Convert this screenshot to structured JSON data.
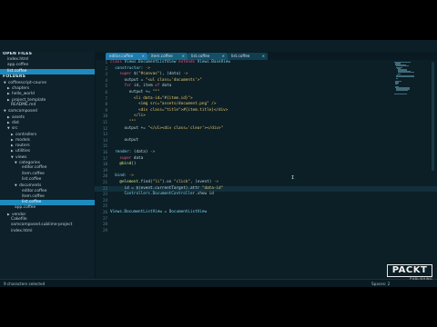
{
  "sidebar": {
    "open_files_heading": "OPEN FILES",
    "open_files": [
      {
        "label": "index.html",
        "indent": 1
      },
      {
        "label": "app.coffee",
        "indent": 1
      },
      {
        "label": "list.coffee",
        "indent": 1,
        "selected": true
      }
    ],
    "folders_heading": "FOLDERS",
    "folders": [
      {
        "label": "coffeescript-course",
        "indent": 0,
        "tri": "▼"
      },
      {
        "label": "chapters",
        "indent": 1,
        "tri": "▶"
      },
      {
        "label": "hello_world",
        "indent": 1,
        "tri": "▶"
      },
      {
        "label": "project_template",
        "indent": 1,
        "tri": "▶"
      },
      {
        "label": "README.md",
        "indent": 2
      },
      {
        "label": "samcomposed",
        "indent": 0,
        "tri": "▼"
      },
      {
        "label": "assets",
        "indent": 1,
        "tri": "▶"
      },
      {
        "label": "dist",
        "indent": 1,
        "tri": "▶"
      },
      {
        "label": "src",
        "indent": 1,
        "tri": "▼"
      },
      {
        "label": "controllers",
        "indent": 2,
        "tri": "▶"
      },
      {
        "label": "models",
        "indent": 2,
        "tri": "▶"
      },
      {
        "label": "routers",
        "indent": 2,
        "tri": "▶"
      },
      {
        "label": "utilities",
        "indent": 2,
        "tri": "▶"
      },
      {
        "label": "views",
        "indent": 2,
        "tri": "▼"
      },
      {
        "label": "categories",
        "indent": 3,
        "tri": "▼"
      },
      {
        "label": "editor.coffee",
        "indent": 5
      },
      {
        "label": "item.coffee",
        "indent": 5
      },
      {
        "label": "list.coffee",
        "indent": 5
      },
      {
        "label": "documents",
        "indent": 3,
        "tri": "▼"
      },
      {
        "label": "editor.coffee",
        "indent": 5
      },
      {
        "label": "item.coffee",
        "indent": 5
      },
      {
        "label": "list.coffee",
        "indent": 5,
        "selected": true
      },
      {
        "label": "app.coffee",
        "indent": 3
      },
      {
        "label": "vendor",
        "indent": 1,
        "tri": "▶"
      },
      {
        "label": "Cakefile",
        "indent": 2
      },
      {
        "label": "samcomposed.sublime-project",
        "indent": 2
      },
      {
        "label": "index.html",
        "indent": 2
      }
    ]
  },
  "tabs": [
    {
      "label": "editor.coffee",
      "cls": "t1"
    },
    {
      "label": "item.coffee",
      "cls": "t2"
    },
    {
      "label": "list.coffee",
      "cls": "t3"
    },
    {
      "label": "list.coffee",
      "cls": "t4"
    }
  ],
  "tab_close": "×",
  "editor": {
    "highlight_line": 22,
    "lines": [
      {
        "n": "1",
        "html": "<span class='k'>class</span> <span class='f'>Views.DocumentListView</span> <span class='k'>extends</span> <span class='f'>Views.BaseView</span>"
      },
      {
        "n": "2",
        "html": "  <span class='f'>constructor</span>: <span class='p'>-&gt;</span>"
      },
      {
        "n": "3",
        "html": "    <span class='k'>super</span> $(<span class='s'>\"#canvas\"</span>), (data) <span class='p'>-&gt;</span>"
      },
      {
        "n": "4",
        "html": "      output = <span class='s'>\"&lt;ul class='documents'&gt;\"</span>"
      },
      {
        "n": "5",
        "html": "      <span class='k'>for</span> id, item <span class='k'>of</span> data"
      },
      {
        "n": "6",
        "html": "        output += <span class='s'>\"\"\"</span>"
      },
      {
        "n": "7",
        "html": "<span class='s'>          &lt;li data-id=\"#{item.id}\"&gt;</span>"
      },
      {
        "n": "8",
        "html": "<span class='s'>            &lt;img src=\"assets/document.png\" /&gt;</span>"
      },
      {
        "n": "9",
        "html": "<span class='s'>            &lt;div class=\"title\"&gt;#{item.title}&lt;/div&gt;</span>"
      },
      {
        "n": "10",
        "html": "<span class='s'>          &lt;/li&gt;</span>"
      },
      {
        "n": "11",
        "html": "<span class='s'>        \"\"\"</span>"
      },
      {
        "n": "12",
        "html": "      output += <span class='s'>\"&lt;/ul&gt;&lt;div class='clear'&gt;&lt;/div&gt;\"</span>"
      },
      {
        "n": "13",
        "html": ""
      },
      {
        "n": "14",
        "html": "      output"
      },
      {
        "n": "15",
        "html": ""
      },
      {
        "n": "16",
        "html": "  <span class='f'>render</span>: (data) <span class='p'>-&gt;</span>"
      },
      {
        "n": "17",
        "html": "    <span class='k'>super</span> data"
      },
      {
        "n": "18",
        "html": "    <span class='v'>@bind</span>()"
      },
      {
        "n": "19",
        "html": ""
      },
      {
        "n": "20",
        "html": "  <span class='f'>bind</span>: <span class='p'>-&gt;</span>"
      },
      {
        "n": "21",
        "html": "    <span class='v'>@element</span>.find(<span class='s'>\"li\"</span>).on <span class='s'>\"click\"</span>, (event) <span class='p'>-&gt;</span>"
      },
      {
        "n": "22",
        "html": "      id = $(event.currentTarget).attr <span class='s'>\"data-id\"</span>"
      },
      {
        "n": "23",
        "html": "      <span class='f'>Controllers.DocumentController</span>.show id"
      },
      {
        "n": "24",
        "html": ""
      },
      {
        "n": "25",
        "html": ""
      },
      {
        "n": "26",
        "html": "<span class='f'>Views.DocumentListView</span> = <span class='f'>DocumentListView</span>"
      },
      {
        "n": "27",
        "html": ""
      },
      {
        "n": "28",
        "html": ""
      },
      {
        "n": "29",
        "html": ""
      }
    ]
  },
  "status": {
    "left": "9 characters selected",
    "right": "Spaces: 2"
  },
  "logo": {
    "text": "PACKT",
    "sub": "PUBLISHING"
  },
  "colors": {
    "accent": "#1e8bc0",
    "editor_bg": "#0c1e26"
  }
}
